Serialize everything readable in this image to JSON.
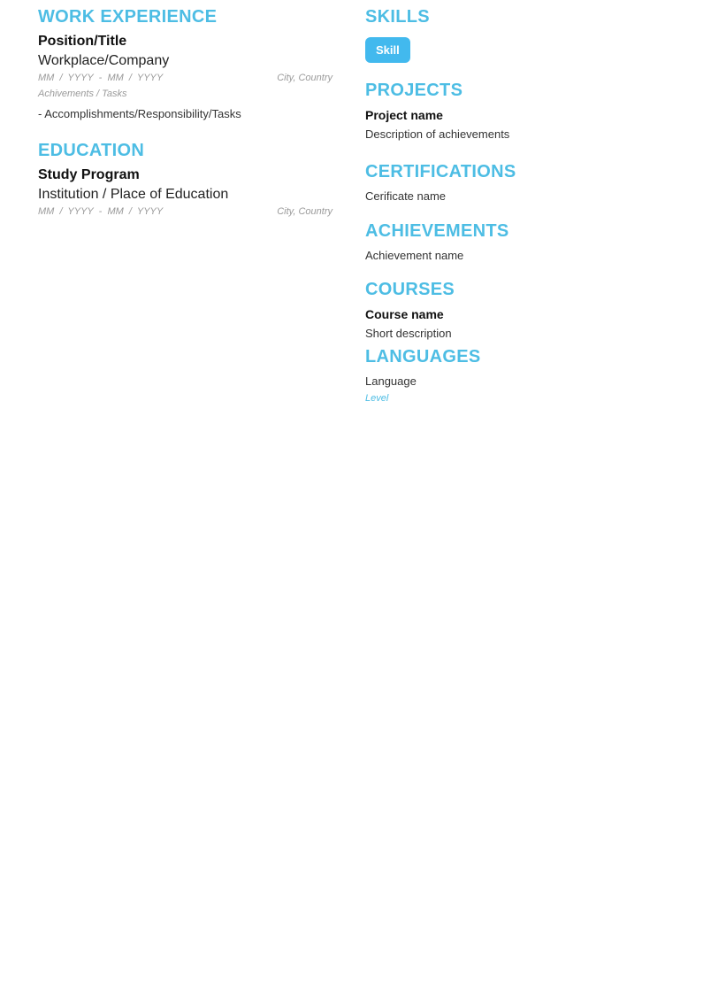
{
  "left": {
    "work_experience": {
      "heading": "WORK EXPERIENCE",
      "position": "Position/Title",
      "company": "Workplace/Company",
      "dates": "MM  /  YYYY  -  MM  /  YYYY",
      "location": "City, Country",
      "note": "Achivements / Tasks",
      "bullet": "- Accomplishments/Responsibility/Tasks"
    },
    "education": {
      "heading": "EDUCATION",
      "program": "Study Program",
      "institution": "Institution / Place of Education",
      "dates": "MM  /  YYYY  -  MM  /  YYYY",
      "location": "City, Country"
    }
  },
  "right": {
    "skills": {
      "heading": "SKILLS",
      "items": [
        "Skill"
      ]
    },
    "projects": {
      "heading": "PROJECTS",
      "name": "Project name",
      "description": "Description of achievements"
    },
    "certifications": {
      "heading": "CERTIFICATIONS",
      "name": "Cerificate name"
    },
    "achievements": {
      "heading": "ACHIEVEMENTS",
      "name": "Achievement name"
    },
    "courses": {
      "heading": "COURSES",
      "name": "Course name",
      "description": "Short description"
    },
    "languages": {
      "heading": "LANGUAGES",
      "name": "Language",
      "level": "Level"
    }
  },
  "colors": {
    "accent": "#4dbde4",
    "pill": "#42b9ee",
    "muted": "#9a9a9a"
  }
}
